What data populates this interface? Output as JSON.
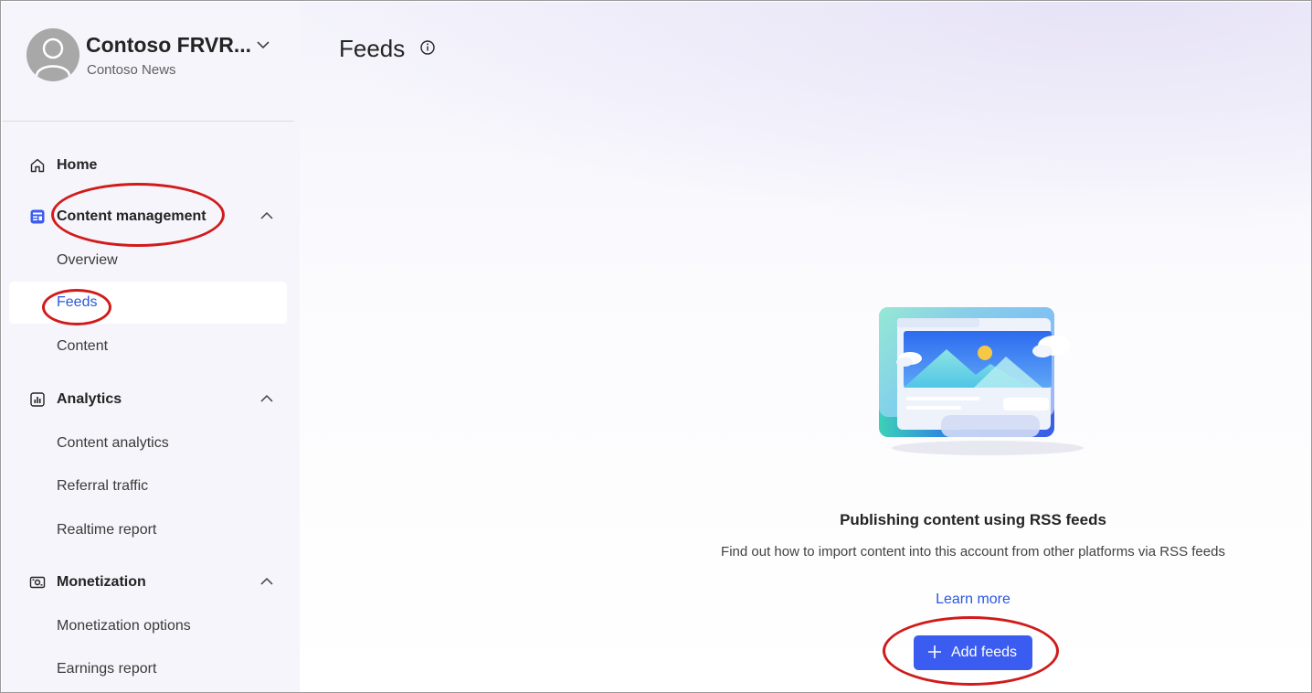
{
  "account": {
    "name": "Contoso FRVR...",
    "subtitle": "Contoso News"
  },
  "sidebar": {
    "home": "Home",
    "content_management": {
      "label": "Content management",
      "items": [
        "Overview",
        "Feeds",
        "Content"
      ]
    },
    "analytics": {
      "label": "Analytics",
      "items": [
        "Content analytics",
        "Referral traffic",
        "Realtime report"
      ]
    },
    "monetization": {
      "label": "Monetization",
      "items": [
        "Monetization options",
        "Earnings report"
      ]
    },
    "selected": "Feeds"
  },
  "main": {
    "title": "Feeds",
    "empty_state": {
      "title": "Publishing content using RSS feeds",
      "description": "Find out how to import content into this account from other platforms via RSS feeds",
      "link": "Learn more",
      "button": "Add feeds"
    }
  },
  "colors": {
    "accent": "#2b57e0",
    "button": "#3b5cf0",
    "annotation": "#d11b1b",
    "sidebar_bg": "#f5f5fb"
  },
  "icons": {
    "home": "home-icon",
    "content_management": "content-management-icon",
    "analytics": "analytics-icon",
    "monetization": "monetization-icon",
    "info": "info-icon",
    "chevron_down": "chevron-down-icon",
    "chevron_up": "chevron-up-icon",
    "plus": "plus-icon"
  }
}
